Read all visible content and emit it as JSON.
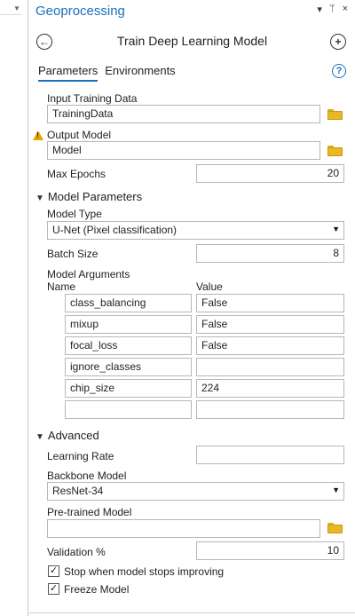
{
  "panel": {
    "title": "Geoprocessing",
    "ctrl_dropdown": "▾",
    "ctrl_pin": "ᛘ",
    "ctrl_close": "×"
  },
  "tool": {
    "title": "Train Deep Learning Model",
    "back_icon": "arrow-left-circle-icon",
    "add_icon": "plus-circle-icon"
  },
  "tabs": [
    "Parameters",
    "Environments"
  ],
  "help_icon": "?",
  "params": {
    "input_training_data": {
      "label": "Input Training Data",
      "value": "TrainingData"
    },
    "output_model": {
      "label": "Output Model",
      "value": "Model"
    },
    "max_epochs": {
      "label": "Max Epochs",
      "value": "20"
    }
  },
  "model_parameters": {
    "header": "Model Parameters",
    "model_type": {
      "label": "Model Type",
      "value": "U-Net (Pixel classification)"
    },
    "batch_size": {
      "label": "Batch Size",
      "value": "8"
    },
    "model_arguments": {
      "label": "Model Arguments",
      "col_name": "Name",
      "col_value": "Value",
      "rows": [
        {
          "name": "class_balancing",
          "value": "False"
        },
        {
          "name": "mixup",
          "value": "False"
        },
        {
          "name": "focal_loss",
          "value": "False"
        },
        {
          "name": "ignore_classes",
          "value": ""
        },
        {
          "name": "chip_size",
          "value": "224"
        },
        {
          "name": "",
          "value": ""
        }
      ]
    }
  },
  "advanced": {
    "header": "Advanced",
    "learning_rate": {
      "label": "Learning Rate",
      "value": ""
    },
    "backbone_model": {
      "label": "Backbone Model",
      "value": "ResNet-34"
    },
    "pretrained_model": {
      "label": "Pre-trained Model",
      "value": ""
    },
    "validation": {
      "label": "Validation %",
      "value": "10"
    },
    "stop_when_improving": {
      "label": "Stop when model stops improving",
      "checked": true
    },
    "freeze_model": {
      "label": "Freeze Model",
      "checked": true
    }
  },
  "colors": {
    "accent": "#1a6fbf",
    "folder": "#e8b923",
    "warning": "#e6a400"
  }
}
